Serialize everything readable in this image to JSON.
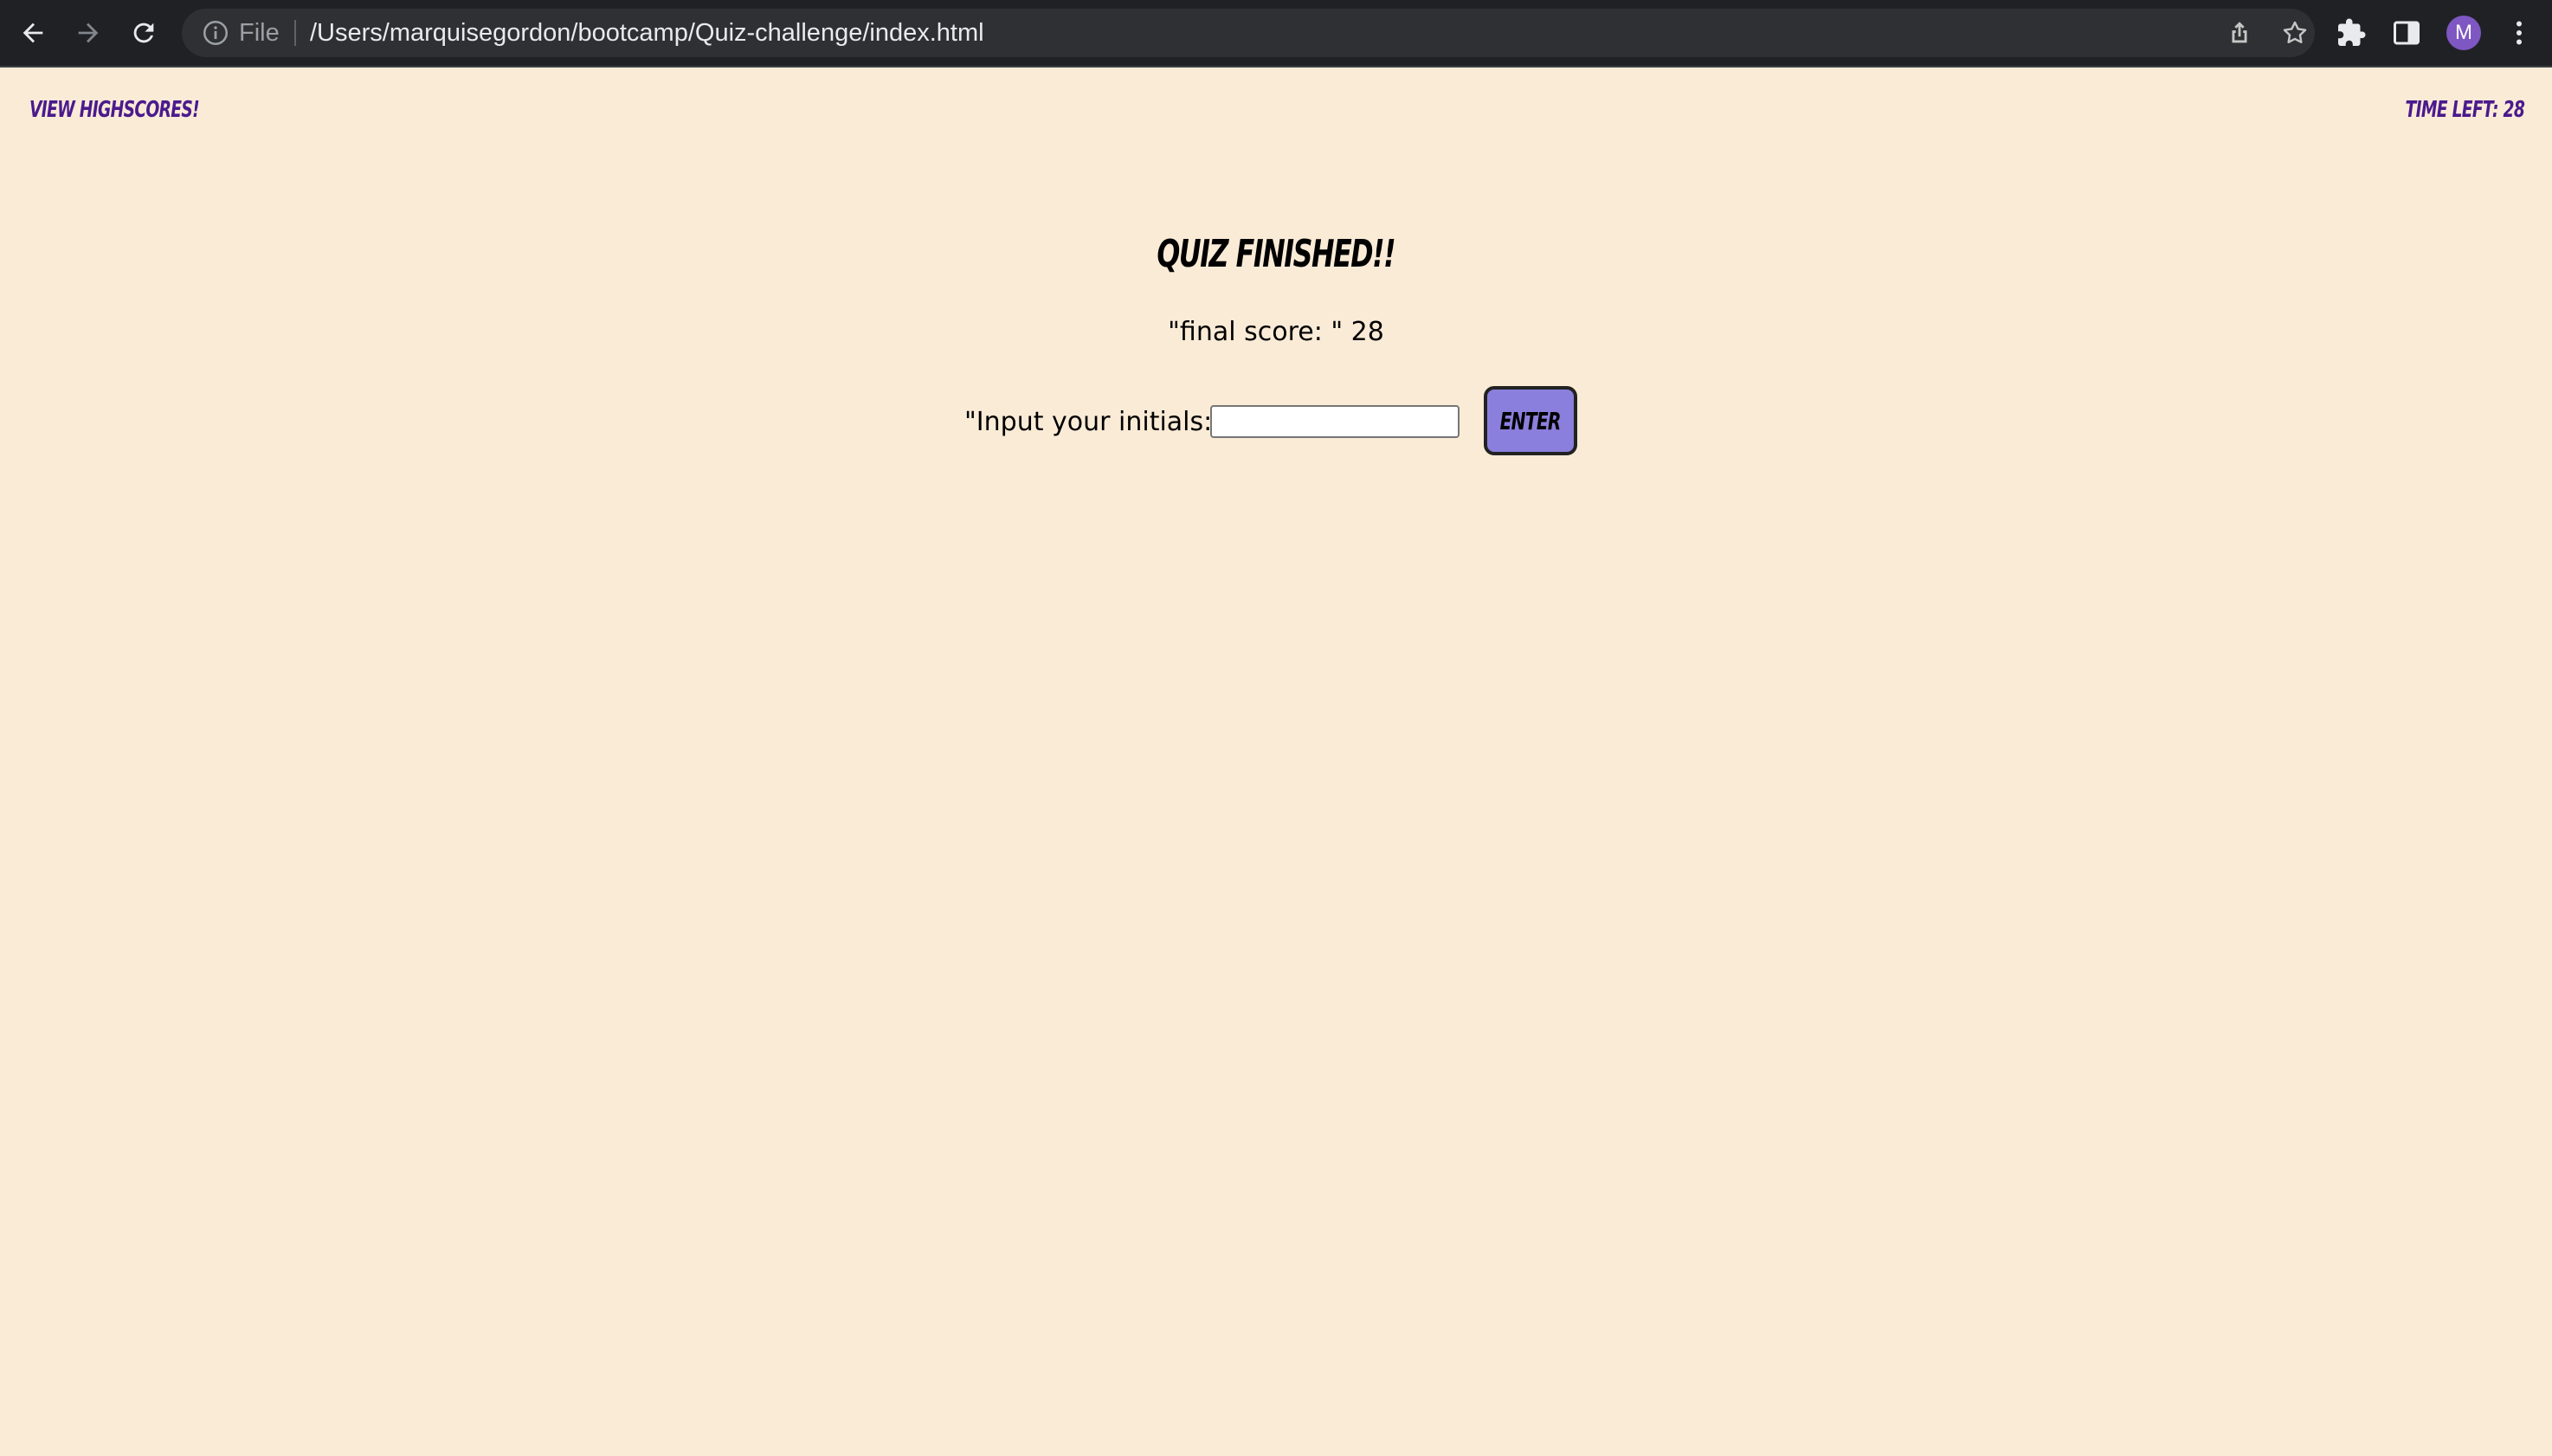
{
  "browser": {
    "scheme_label": "File",
    "url": "/Users/marquisegordon/bootcamp/Quiz-challenge/index.html",
    "profile_initial": "M",
    "icons": [
      "back-arrow-icon",
      "forward-arrow-icon",
      "reload-icon",
      "info-icon",
      "share-icon",
      "star-icon",
      "extensions-puzzle-icon",
      "side-panel-icon",
      "kebab-menu-icon"
    ],
    "chrome_color": "#202124",
    "avatar_color": "#7e57c2"
  },
  "page": {
    "view_highscores": "View Highscores!",
    "time_left": "Time left: 28",
    "title": "Quiz Finished!!",
    "score_text": "\"final score: \" 28",
    "initials_label": "\"Input your initials: \"",
    "initials_value": "",
    "enter_label": "Enter",
    "background_color": "#faebd7",
    "accent_color": "#4b1a8c",
    "button_color": "#8a7fdc"
  }
}
